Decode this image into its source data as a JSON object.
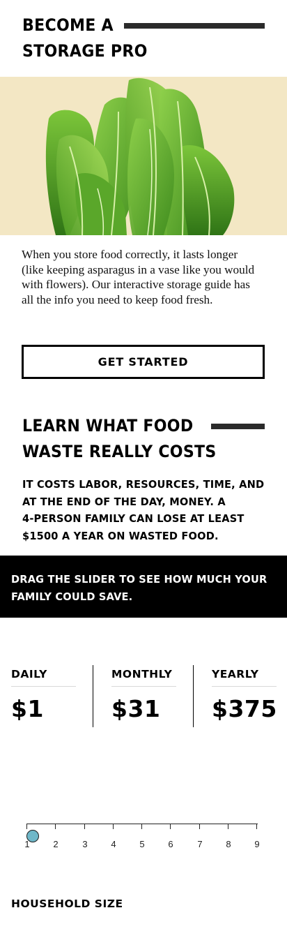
{
  "section1": {
    "heading_line1": "BECOME A",
    "heading_line2": "STORAGE PRO",
    "hero_image": "leafy-greens-illustration",
    "intro": "When you store food correctly, it lasts longer (like keeping asparagus in a vase like you would with flowers). Our interactive storage guide has all the info you need to keep food fresh.",
    "cta_label": "GET STARTED"
  },
  "section2": {
    "heading_line1": "LEARN WHAT FOOD",
    "heading_line2": "WASTE REALLY COSTS",
    "subtext_lines": [
      "IT COSTS LABOR, RESOURCES, TIME, AND",
      "AT THE END OF THE DAY, MONEY. A",
      "4-PERSON FAMILY CAN LOSE AT LEAST",
      "$1500 A YEAR ON WASTED FOOD."
    ],
    "banner_lines": [
      "DRAG THE SLIDER TO SEE HOW MUCH YOUR",
      "FAMILY COULD SAVE."
    ]
  },
  "savings": [
    {
      "label": "DAILY",
      "value": "$1"
    },
    {
      "label": "MONTHLY",
      "value": "$31"
    },
    {
      "label": "YEARLY",
      "value": "$375"
    }
  ],
  "slider": {
    "ticks": [
      "1",
      "2",
      "3",
      "4",
      "5",
      "6",
      "7",
      "8",
      "9"
    ],
    "value": 1,
    "min": 1,
    "max": 9,
    "label": "HOUSEHOLD SIZE"
  },
  "colors": {
    "hero_background": "#f3e7c4",
    "rule": "#2b2b2b",
    "banner_background": "#000000",
    "slider_thumb": "#6fb7c8"
  }
}
